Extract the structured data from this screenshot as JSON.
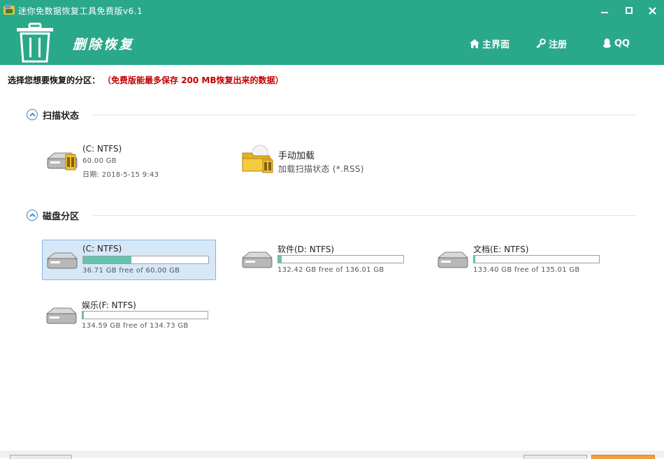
{
  "window": {
    "title": "迷你免数据恢复工具免费版v6.1"
  },
  "header": {
    "app_name": "删除恢复",
    "nav": [
      {
        "label": "主界面",
        "icon": "home-icon"
      },
      {
        "label": "注册",
        "icon": "key-icon"
      },
      {
        "label": "QQ",
        "icon": "qq-penguin-icon"
      }
    ]
  },
  "instruction": {
    "text": "选择您想要恢复的分区：",
    "note": "（免费版能最多保存 200 MB恢复出来的数据）"
  },
  "scan_section": {
    "title": "扫描状态",
    "items": [
      {
        "name": "(C: NTFS)",
        "size": "60.00 GB",
        "date": "日期: 2018-5-15 9:43"
      },
      {
        "name": "手动加载",
        "desc": "加载扫描状态 (*.RSS)"
      }
    ]
  },
  "disk_section": {
    "title": "磁盘分区",
    "partitions": [
      {
        "name": "(C: NTFS)",
        "free_text": "36.71 GB free of 60.00 GB",
        "used_fraction": 0.388
      },
      {
        "name": "软件(D: NTFS)",
        "free_text": "132.42 GB free of 136.01 GB",
        "used_fraction": 0.026
      },
      {
        "name": "文档(E: NTFS)",
        "free_text": "133.40 GB free of 135.01 GB",
        "used_fraction": 0.012
      },
      {
        "name": "娱乐(F: NTFS)",
        "free_text": "134.59 GB free of 134.73 GB",
        "used_fraction": 0.001
      }
    ]
  },
  "colors": {
    "brand": "#2aa88a",
    "warning": "#c00000",
    "selection": "#d6e8f8",
    "usage_bar": "#62c4b0"
  }
}
